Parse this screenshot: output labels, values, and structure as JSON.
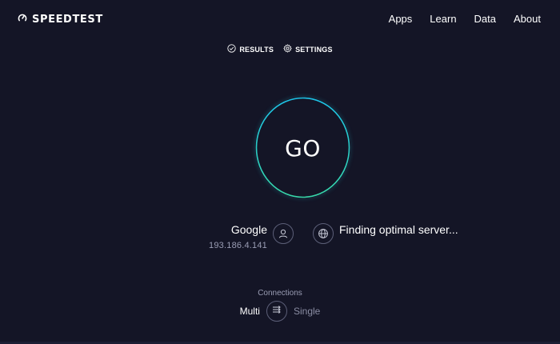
{
  "header": {
    "logo_text": "SPEEDTEST",
    "nav": [
      "Apps",
      "Learn",
      "Data",
      "About"
    ]
  },
  "subnav": {
    "results_label": "RESULTS",
    "settings_label": "SETTINGS"
  },
  "test": {
    "go_label": "GO",
    "ring_gradient": [
      "#1cc3e8",
      "#37d7a9"
    ]
  },
  "isp": {
    "name": "Google",
    "ip": "193.186.4.141"
  },
  "server": {
    "status": "Finding optimal server..."
  },
  "connections": {
    "label": "Connections",
    "multi": "Multi",
    "single": "Single",
    "selected": "Multi"
  },
  "colors": {
    "background": "#141526",
    "muted_text": "#9a9db4",
    "icon_border": "#5c5f78"
  },
  "icons": [
    "speedometer-icon",
    "check-circle-icon",
    "gear-icon",
    "user-icon",
    "globe-icon",
    "arrows-icon"
  ]
}
